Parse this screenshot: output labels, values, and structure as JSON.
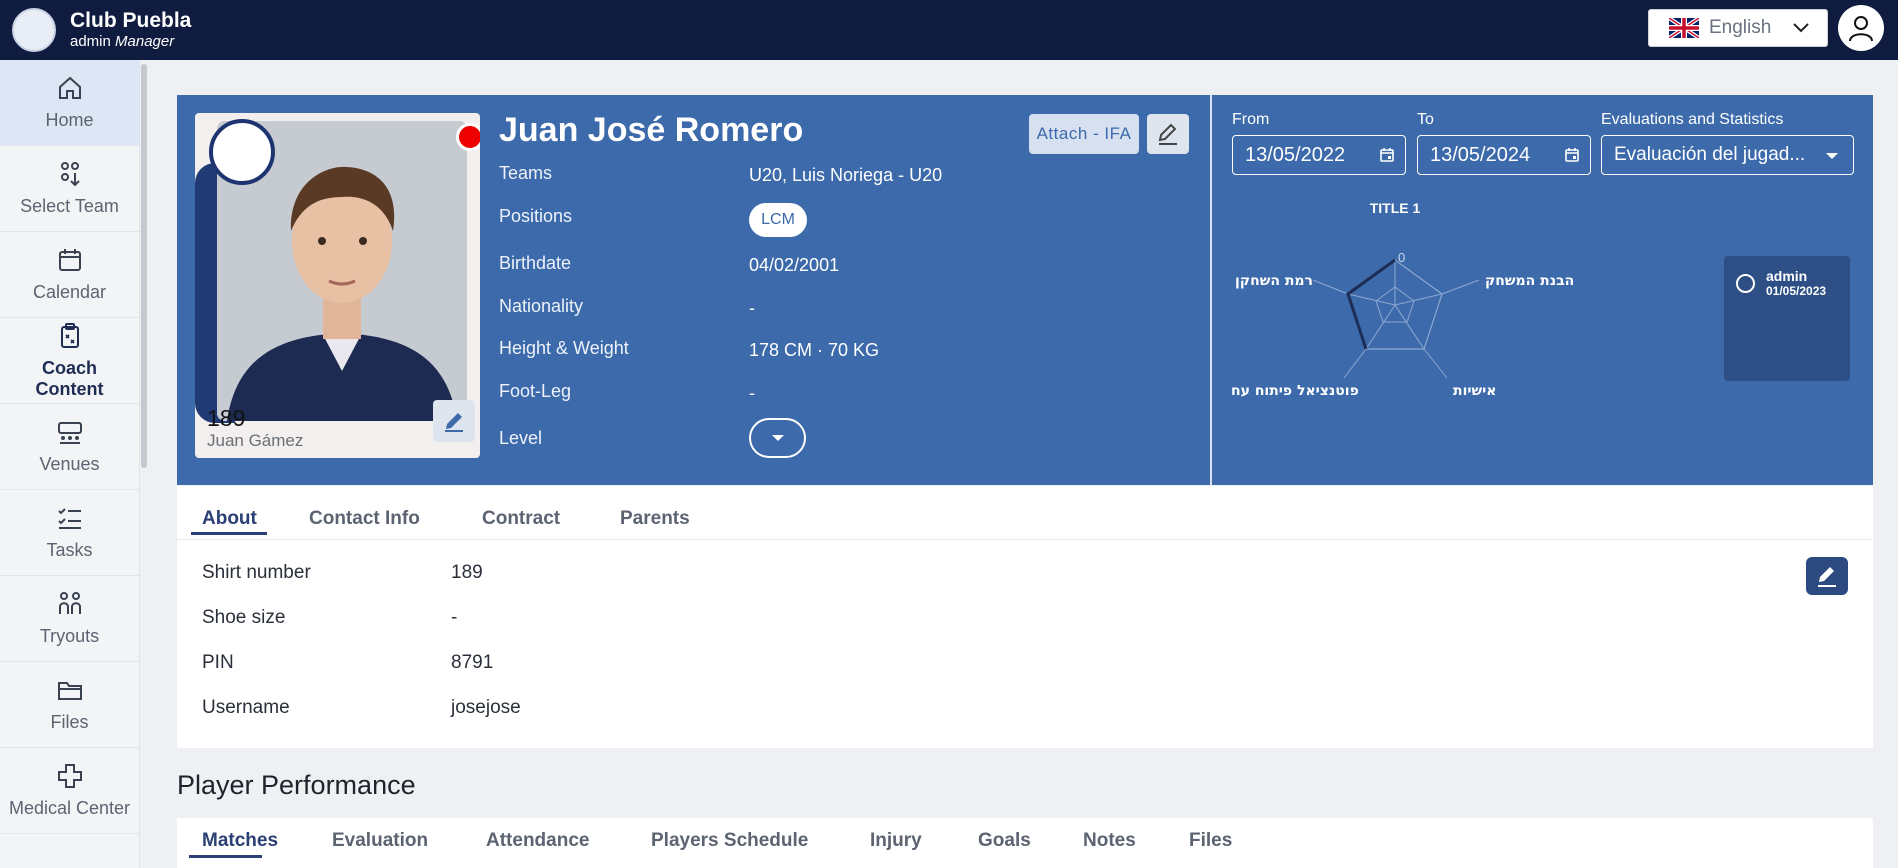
{
  "header": {
    "club_name": "Club Puebla",
    "role_prefix": "admin",
    "role": "Manager",
    "logo_text": "Puebla",
    "language": "English"
  },
  "sidebar": {
    "items": [
      {
        "label": "Home",
        "icon": "home-icon"
      },
      {
        "label": "Select Team",
        "icon": "team-icon"
      },
      {
        "label": "Calendar",
        "icon": "calendar-icon"
      },
      {
        "label": "Coach Content",
        "icon": "clipboard-icon"
      },
      {
        "label": "Venues",
        "icon": "venues-icon"
      },
      {
        "label": "Tasks",
        "icon": "tasks-icon"
      },
      {
        "label": "Tryouts",
        "icon": "tryouts-icon"
      },
      {
        "label": "Files",
        "icon": "folder-icon"
      },
      {
        "label": "Medical Center",
        "icon": "medical-icon"
      }
    ]
  },
  "player": {
    "name": "Juan José Romero",
    "card_number": "189",
    "card_name": "Juan Gámez",
    "attach_label": "Attach - IFA",
    "fields": {
      "teams_label": "Teams",
      "teams_value": "U20, Luis Noriega - U20",
      "positions_label": "Positions",
      "positions_value": "LCM",
      "birthdate_label": "Birthdate",
      "birthdate_value": "04/02/2001",
      "nationality_label": "Nationality",
      "nationality_value": "-",
      "hw_label": "Height & Weight",
      "hw_value": "178 CM · 70 KG",
      "foot_label": "Foot-Leg",
      "foot_value": "-",
      "level_label": "Level"
    }
  },
  "filters": {
    "from_label": "From",
    "from_value": "13/05/2022",
    "to_label": "To",
    "to_value": "13/05/2024",
    "eval_label": "Evaluations and Statistics",
    "eval_value": "Evaluación del jugad..."
  },
  "radar": {
    "title": "TITLE 1",
    "zero_tick": "0",
    "axes": [
      "הבנת המשחק",
      "אישיות",
      "פוטנציאל פיתוח עח",
      "רמת השחקן"
    ],
    "legend_name": "admin",
    "legend_date": "01/05/2023"
  },
  "about": {
    "tabs": [
      "About",
      "Contact Info",
      "Contract",
      "Parents"
    ],
    "rows": [
      {
        "label": "Shirt number",
        "value": "189"
      },
      {
        "label": "Shoe size",
        "value": "-"
      },
      {
        "label": "PIN",
        "value": "8791"
      },
      {
        "label": "Username",
        "value": "josejose"
      }
    ]
  },
  "performance": {
    "title": "Player Performance",
    "tabs": [
      "Matches",
      "Evaluation",
      "Attendance",
      "Players Schedule",
      "Injury",
      "Goals",
      "Notes",
      "Files"
    ]
  },
  "colors": {
    "topbar": "#0f1c3f",
    "profile_bg": "#3c6aab",
    "accent": "#2a3f74",
    "status_dot": "#ee0000"
  }
}
